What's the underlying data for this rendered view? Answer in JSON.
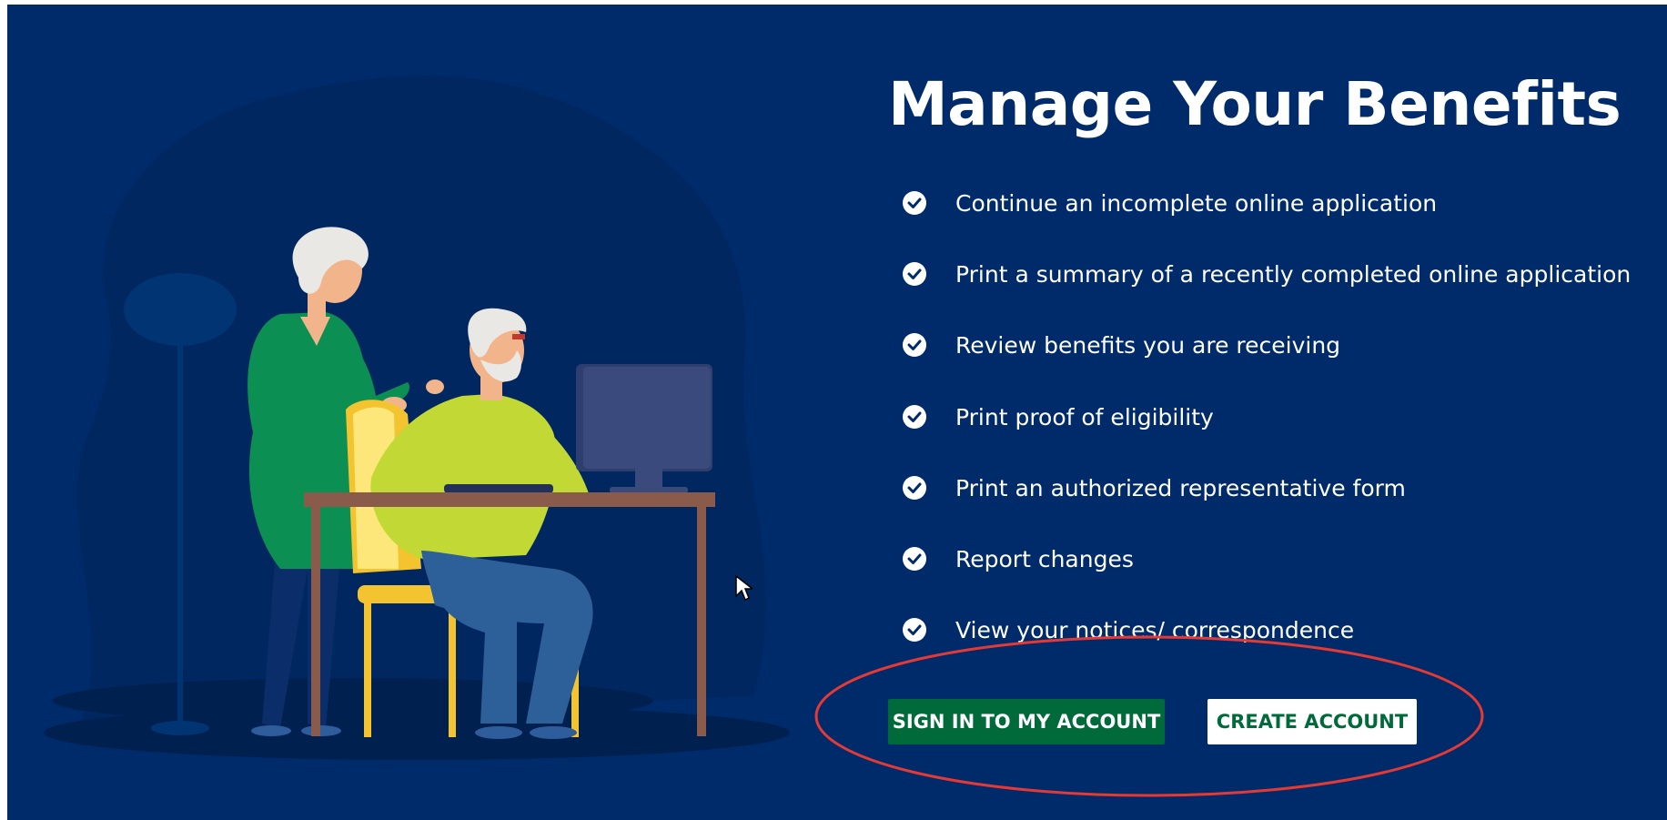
{
  "page": {
    "title": "Manage Your Benefits",
    "features": [
      "Continue an incomplete online application",
      "Print a summary of a recently completed online application",
      "Review benefits you are receiving",
      "Print proof of eligibility",
      "Print an authorized representative form",
      "Report changes",
      "View your notices/ correspondence"
    ],
    "feature_icon": "check-circle-icon"
  },
  "actions": {
    "sign_in_label": "SIGN IN TO MY ACCOUNT",
    "create_account_label": "CREATE ACCOUNT"
  },
  "colors": {
    "background": "#002b6b",
    "primary_button": "#006a3a",
    "secondary_button_text": "#006a3a",
    "highlight_annotation": "#e53935"
  }
}
